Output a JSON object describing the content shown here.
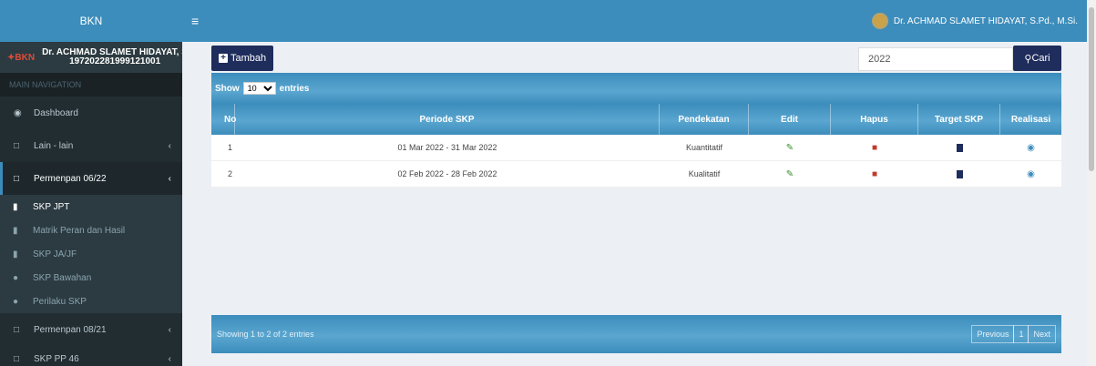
{
  "brand": {
    "title": "BKN"
  },
  "header": {
    "user_name": "Dr. ACHMAD SLAMET HIDAYAT, S.Pd., M.Si."
  },
  "sidebar": {
    "logo_text": "BKN",
    "user_name": "Dr. ACHMAD SLAMET HIDAYAT, S",
    "user_nip": "197202281999121001",
    "nav_header": "MAIN NAVIGATION",
    "items": [
      {
        "label": "Dashboard",
        "icon": "dashboard-icon"
      },
      {
        "label": "Lain - lain",
        "icon": "folder-icon"
      },
      {
        "label": "Permenpan 06/22",
        "icon": "folder-icon"
      },
      {
        "label": "Permenpan 08/21",
        "icon": "folder-icon"
      },
      {
        "label": "SKP PP 46",
        "icon": "folder-icon"
      }
    ],
    "subitems": [
      {
        "label": "SKP JPT",
        "icon": "book-icon"
      },
      {
        "label": "Matrik Peran dan Hasil",
        "icon": "book-icon"
      },
      {
        "label": "SKP JA/JF",
        "icon": "book-icon"
      },
      {
        "label": "SKP Bawahan",
        "icon": "users-icon"
      },
      {
        "label": "Perilaku SKP",
        "icon": "users-icon"
      }
    ]
  },
  "toolbar": {
    "add_label": "Tambah",
    "search_value": "2022",
    "search_label": "Cari"
  },
  "table": {
    "show_label": "Show",
    "entries_label": "entries",
    "page_size": "10",
    "headers": [
      "No",
      "Periode SKP",
      "Pendekatan",
      "Edit",
      "Hapus",
      "Target SKP",
      "Realisasi"
    ],
    "rows": [
      {
        "no": "1",
        "periode": "01 Mar 2022 - 31 Mar 2022",
        "pendekatan": "Kuantitatif"
      },
      {
        "no": "2",
        "periode": "02 Feb 2022 - 28 Feb 2022",
        "pendekatan": "Kualitatif"
      }
    ],
    "info": "Showing 1 to 2 of 2 entries",
    "pager": {
      "previous": "Previous",
      "page": "1",
      "next": "Next"
    }
  },
  "colors": {
    "primary": "#3c8dbc",
    "navy": "#1f2d5c",
    "sidebar": "#222d32"
  }
}
